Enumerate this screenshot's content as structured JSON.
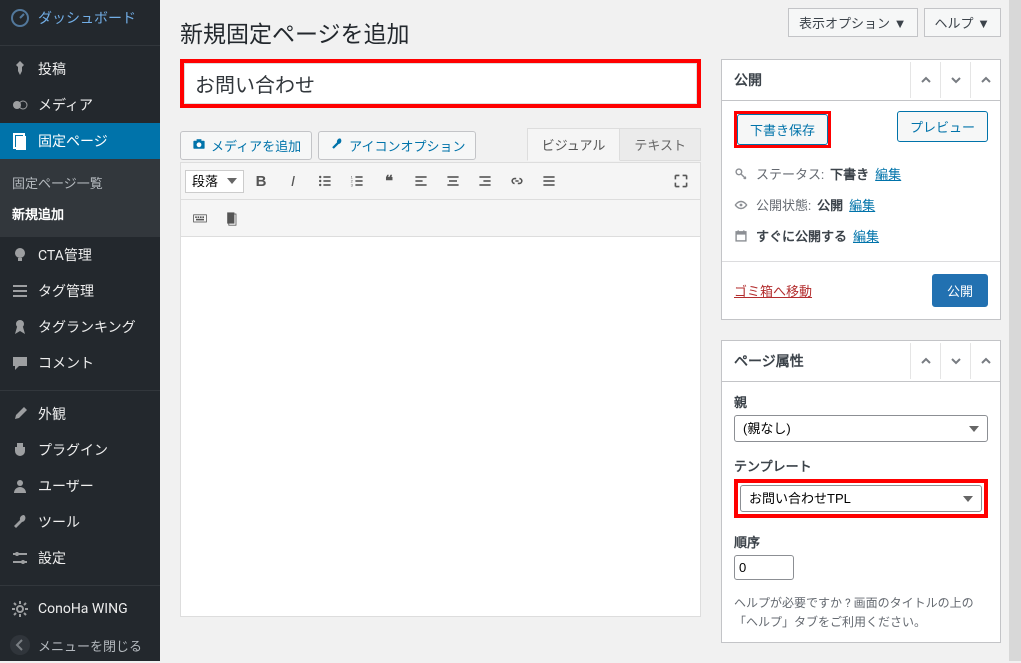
{
  "sidebar": {
    "items": [
      {
        "label": "ダッシュボード",
        "icon": "dashboard"
      },
      {
        "label": "投稿",
        "icon": "pin"
      },
      {
        "label": "メディア",
        "icon": "media"
      },
      {
        "label": "固定ページ",
        "icon": "page",
        "current": true
      },
      {
        "label": "CTA管理",
        "icon": "bulb"
      },
      {
        "label": "タグ管理",
        "icon": "list"
      },
      {
        "label": "タグランキング",
        "icon": "award"
      },
      {
        "label": "コメント",
        "icon": "comment"
      },
      {
        "label": "外観",
        "icon": "brush"
      },
      {
        "label": "プラグイン",
        "icon": "plug"
      },
      {
        "label": "ユーザー",
        "icon": "user"
      },
      {
        "label": "ツール",
        "icon": "wrench"
      },
      {
        "label": "設定",
        "icon": "settings"
      },
      {
        "label": "ConoHa WING",
        "icon": "gear"
      }
    ],
    "sub": {
      "list": "固定ページ一覧",
      "add": "新規追加"
    },
    "collapse": "メニューを閉じる"
  },
  "header": {
    "screen_options": "表示オプション ▼",
    "help": "ヘルプ ▼",
    "title": "新規固定ページを追加"
  },
  "title_input": {
    "value": "お問い合わせ"
  },
  "media": {
    "add_media": "メディアを追加",
    "icon_options": "アイコンオプション"
  },
  "editor": {
    "tabs": {
      "visual": "ビジュアル",
      "text": "テキスト"
    },
    "format": "段落"
  },
  "publish": {
    "box_title": "公開",
    "save_draft": "下書き保存",
    "preview": "プレビュー",
    "status_label": "ステータス:",
    "status_value": "下書き",
    "visibility_label": "公開状態:",
    "visibility_value": "公開",
    "schedule_label": "すぐに公開する",
    "edit": "編集",
    "trash": "ゴミ箱へ移動",
    "publish_btn": "公開"
  },
  "attributes": {
    "box_title": "ページ属性",
    "parent_label": "親",
    "parent_value": "(親なし)",
    "template_label": "テンプレート",
    "template_value": "お問い合わせTPL",
    "order_label": "順序",
    "order_value": "0",
    "help": "ヘルプが必要ですか ? 画面のタイトルの上の「ヘルプ」タブをご利用ください。"
  }
}
